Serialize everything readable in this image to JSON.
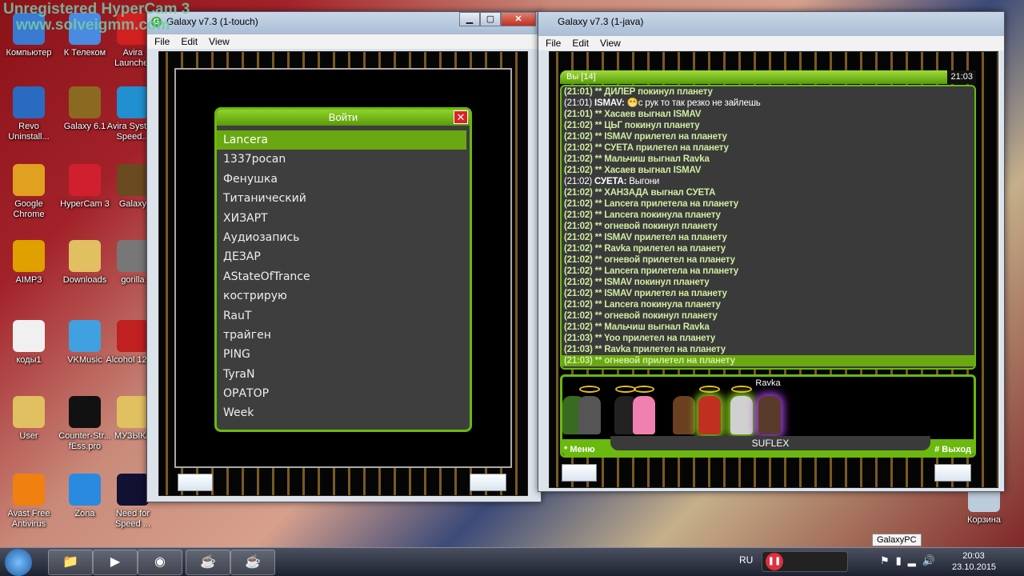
{
  "watermark": {
    "line1": "Unregistered HyperCam 3",
    "line2": "www.solveigmm.com"
  },
  "desktop_icons": [
    {
      "label": "Компьютер",
      "color": "#3a7ad0"
    },
    {
      "label": "К Телеком",
      "color": "#4a8ae0"
    },
    {
      "label": "Avira Launcher",
      "color": "#d02020"
    },
    {
      "label": "Revo Uninstall...",
      "color": "#2a6ac0"
    },
    {
      "label": "Galaxy 6.1",
      "color": "#8a6a20"
    },
    {
      "label": "Avira System Speed...",
      "color": "#2090d0"
    },
    {
      "label": "Google Chrome",
      "color": "#e0a020"
    },
    {
      "label": "HyperCam 3",
      "color": "#d02030"
    },
    {
      "label": "Galaxy",
      "color": "#6a4a20"
    },
    {
      "label": "AIMP3",
      "color": "#e0a000"
    },
    {
      "label": "Downloads",
      "color": "#e0c060"
    },
    {
      "label": "gorilla",
      "color": "#777"
    },
    {
      "label": "коды1",
      "color": "#f0f0f0"
    },
    {
      "label": "VKMusic",
      "color": "#40a0e0"
    },
    {
      "label": "Alcohol 120%",
      "color": "#c02020"
    },
    {
      "label": "User",
      "color": "#e0c060"
    },
    {
      "label": "Counter-Str... fEss.pro",
      "color": "#111"
    },
    {
      "label": "МУЗЫКА",
      "color": "#e0c060"
    },
    {
      "label": "Avast Free Antivirus",
      "color": "#f08010"
    },
    {
      "label": "Zona",
      "color": "#2a8ae0"
    },
    {
      "label": "Need for Speed ...",
      "color": "#113"
    }
  ],
  "recycle_bin": {
    "label": "Корзина"
  },
  "window_touch": {
    "title": "Galaxy v7.3 (1-touch)",
    "menu": [
      "File",
      "Edit",
      "View"
    ],
    "login": {
      "title": "Войти",
      "items": [
        "Lancera",
        "1337pocan",
        "Фенушка",
        "Титанический",
        "ХИЗАРТ",
        "Аудиозапись",
        "ДЕЗАР",
        "AStateOfTrance",
        "кострирую",
        "RauT",
        "трайген",
        "PING",
        "TyraN",
        "ОРАТОР",
        "Week"
      ],
      "selected": 0
    }
  },
  "window_java": {
    "title": "Galaxy v7.3 (1-java)",
    "menu": [
      "File",
      "Edit",
      "View"
    ],
    "chat": {
      "header": "Вы [14]",
      "time": "21:03",
      "highlighted": 24,
      "lines": [
        {
          "time": "(21:01)",
          "text": "** ДИЛЕР покинул планету"
        },
        {
          "time": "(21:01)",
          "nick": "ISMAV:",
          "text": "😁с рук то так резко не зайлешь"
        },
        {
          "time": "(21:01)",
          "text": "** Хасаев выгнал ISMAV"
        },
        {
          "time": "(21:02)",
          "text": "** ЦЬГ покинул планету"
        },
        {
          "time": "(21:02)",
          "text": "** ISMAV прилетел на планету"
        },
        {
          "time": "(21:02)",
          "text": "** СУЕТА прилетел на планету"
        },
        {
          "time": "(21:02)",
          "text": "** Мальчиш выгнал Ravka"
        },
        {
          "time": "(21:02)",
          "text": "** Хасаев выгнал ISMAV"
        },
        {
          "time": "(21:02)",
          "nick": "СУЕТА:",
          "text": "Выгони"
        },
        {
          "time": "(21:02)",
          "text": "** ХАНЗАДА выгнал СУЕТА"
        },
        {
          "time": "(21:02)",
          "text": "** Lancera прилетела на планету"
        },
        {
          "time": "(21:02)",
          "text": "** Lancera покинула планету"
        },
        {
          "time": "(21:02)",
          "text": "** огневой покинул планету"
        },
        {
          "time": "(21:02)",
          "text": "** ISMAV прилетел на планету"
        },
        {
          "time": "(21:02)",
          "text": "** Ravka прилетел на планету"
        },
        {
          "time": "(21:02)",
          "text": "** огневой прилетел на планету"
        },
        {
          "time": "(21:02)",
          "text": "** Lancera прилетела на планету"
        },
        {
          "time": "(21:02)",
          "text": "** ISMAV покинул планету"
        },
        {
          "time": "(21:02)",
          "text": "** ISMAV прилетел на планету"
        },
        {
          "time": "(21:02)",
          "text": "** Lancera покинула планету"
        },
        {
          "time": "(21:02)",
          "text": "** огневой покинул планету"
        },
        {
          "time": "(21:02)",
          "text": "** Мальчиш выгнал Ravka"
        },
        {
          "time": "(21:03)",
          "text": "** Yoo прилетел на планету"
        },
        {
          "time": "(21:03)",
          "text": "** Ravka прилетел на планету"
        },
        {
          "time": "(21:03)",
          "text": "** огневой прилетел на планету"
        }
      ]
    },
    "planet": {
      "top_name": "Ravka",
      "bottom_name": "SUFLEX",
      "menu_label": "* Меню",
      "exit_label": "# Выход"
    }
  },
  "taskbar": {
    "language": "RU",
    "tooltip": "GalaxyPC",
    "time": "20:03",
    "date": "23.10.2015"
  }
}
